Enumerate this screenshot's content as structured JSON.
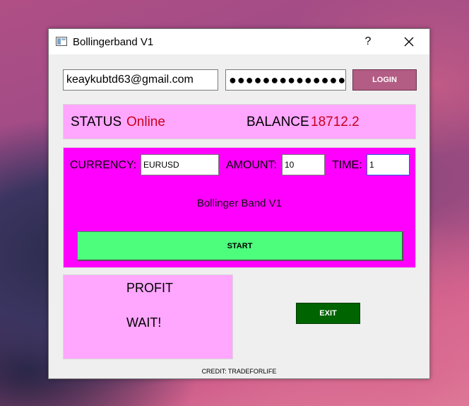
{
  "window": {
    "title": "Bollingerband V1",
    "help_label": "?"
  },
  "login": {
    "email_value": "keaykubtd63@gmail.com",
    "password_mask": "●●●●●●●●●●●●●●",
    "login_label": "LOGIN"
  },
  "status": {
    "status_label": "STATUS",
    "status_value": "Online",
    "balance_label": "BALANCE",
    "balance_value": "18712.2"
  },
  "trade": {
    "currency_label": "CURRENCY:",
    "currency_value": "EURUSD",
    "amount_label": "AMOUNT:",
    "amount_value": "10",
    "time_label": "TIME:",
    "time_value": "1",
    "heading": "Bollinger Band V1",
    "start_label": "START"
  },
  "profit": {
    "label": "PROFIT",
    "value": "WAIT!"
  },
  "exit_label": "EXIT",
  "credit": "CREDIT: TRADEFORLIFE",
  "colors": {
    "status_panel": "#ffa6ff",
    "trade_panel": "#ff00ff",
    "start_button": "#4dfe7d",
    "exit_button": "#006400",
    "login_button": "#b35c84",
    "status_text": "#c8001e"
  }
}
